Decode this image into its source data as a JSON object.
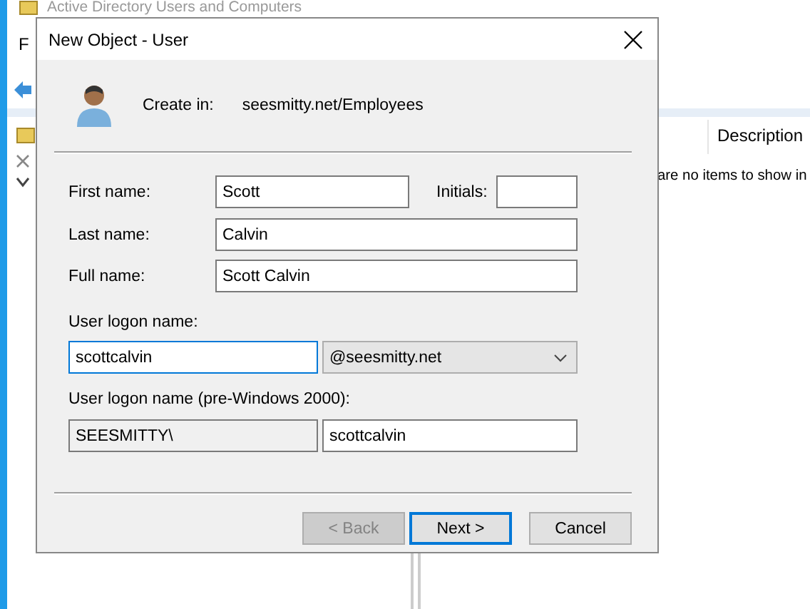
{
  "background_window": {
    "title": "Active Directory Users and Computers",
    "menu_item": "F",
    "columns": [
      "Description"
    ],
    "empty_message": "are no items to show in"
  },
  "dialog": {
    "title": "New Object - User",
    "create_in_label": "Create in:",
    "create_in_path": "seesmitty.net/Employees",
    "first_name": {
      "label": "First name:",
      "value": "Scott",
      "focused": false
    },
    "initials": {
      "label": "Initials:",
      "focused": false
    },
    "last_name": {
      "label": "Last name:",
      "value": "Calvin",
      "focused": false
    },
    "full_name": {
      "label": "Full name:",
      "value": "Scott Calvin",
      "focused": false
    },
    "logon": {
      "label": "User logon name:",
      "value": "scottcalvin",
      "focused": true,
      "domain": "@seesmitty.net"
    },
    "pre2000": {
      "label": "User logon name (pre-Windows 2000):",
      "domain": "SEESMITTY\\",
      "domain_disabled": true,
      "value": "scottcalvin"
    },
    "buttons": [
      {
        "label": "< Back",
        "disabled": true,
        "default": false
      },
      {
        "label": "Next >",
        "disabled": false,
        "default": true
      },
      {
        "label": "Cancel",
        "disabled": false,
        "default": false
      }
    ]
  }
}
